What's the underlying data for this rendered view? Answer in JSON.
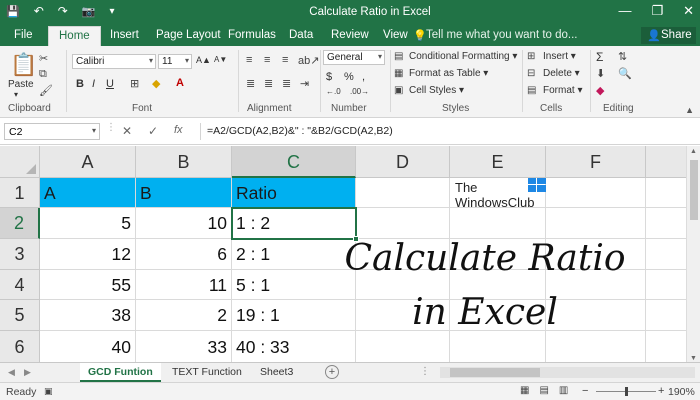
{
  "window": {
    "title": "Calculate Ratio in Excel",
    "controls": [
      "—",
      "❐",
      "✕"
    ]
  },
  "qat": {
    "save": "💾",
    "undo": "↶",
    "redo": "↷",
    "camera": "📷",
    "customize": "▾"
  },
  "ribbon_tabs": [
    "File",
    "Home",
    "Insert",
    "Page Layout",
    "Formulas",
    "Data",
    "Review",
    "View"
  ],
  "active_tab": "Home",
  "tell_me": "Tell me what you want to do...",
  "share": "Share",
  "ribbon": {
    "clipboard": {
      "paste": "Paste",
      "label": "Clipboard"
    },
    "font": {
      "name": "Calibri",
      "size": "11",
      "bold": "B",
      "italic": "I",
      "underline": "U",
      "grow": "A▲",
      "shrink": "A▼",
      "label": "Font"
    },
    "alignment": {
      "label": "Alignment"
    },
    "number": {
      "format": "General",
      "currency": "$",
      "percent": "%",
      "comma": ",",
      "inc": "←.0",
      "dec": ".00→",
      "label": "Number"
    },
    "styles": {
      "conditional": "Conditional Formatting",
      "table": "Format as Table",
      "cell": "Cell Styles",
      "label": "Styles"
    },
    "cells": {
      "insert": "Insert",
      "delete": "Delete",
      "format": "Format",
      "label": "Cells"
    },
    "editing": {
      "sum": "Σ",
      "label": "Editing"
    }
  },
  "formula_bar": {
    "name_box": "C2",
    "cancel": "✕",
    "enter": "✓",
    "fx": "fx",
    "formula": "=A2/GCD(A2,B2)&\" : \"&B2/GCD(A2,B2)"
  },
  "sheet": {
    "columns": [
      "A",
      "B",
      "C",
      "D",
      "E",
      "F"
    ],
    "rows": [
      "1",
      "2",
      "3",
      "4",
      "5",
      "6"
    ],
    "cells": [
      [
        "A",
        "B",
        "Ratio",
        "",
        "",
        ""
      ],
      [
        "5",
        "10",
        "1 : 2",
        "",
        "",
        ""
      ],
      [
        "12",
        "6",
        "2 : 1",
        "",
        "",
        ""
      ],
      [
        "55",
        "11",
        "5 : 1",
        "",
        "",
        ""
      ],
      [
        "38",
        "2",
        "19 : 1",
        "",
        "",
        ""
      ],
      [
        "40",
        "33",
        "40 : 33",
        "",
        "",
        ""
      ]
    ],
    "selected": "C2"
  },
  "watermark": {
    "line1": "The",
    "line2": "WindowsClub"
  },
  "overlay": {
    "line1": "Calculate Ratio",
    "line2": "in Excel"
  },
  "sheet_tabs": [
    "GCD Funtion",
    "TEXT Function",
    "Sheet3"
  ],
  "active_sheet": "GCD Funtion",
  "status": {
    "ready": "Ready",
    "zoom": "190%"
  },
  "colors": {
    "excel_green": "#217346",
    "header_fill": "#00b0f0"
  }
}
